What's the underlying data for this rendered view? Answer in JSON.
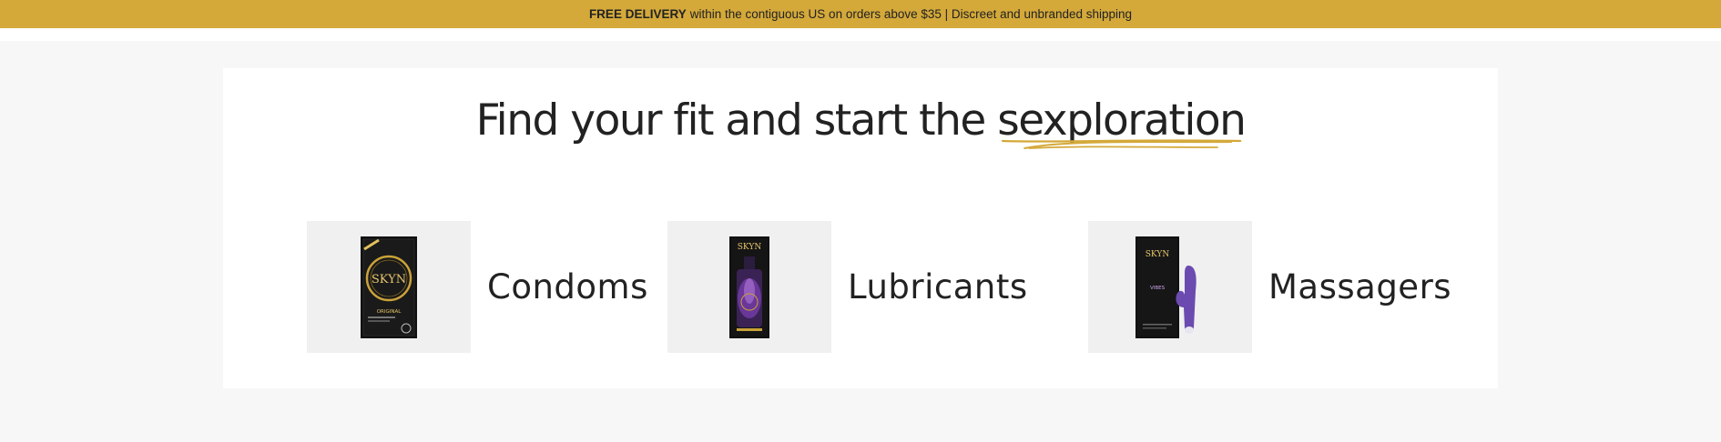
{
  "promo": {
    "bold": "FREE DELIVERY",
    "rest": "within the contiguous US on orders above $35 | Discreet and unbranded shipping"
  },
  "headline": {
    "before": "Find your fit and start the ",
    "highlight": "sexploration"
  },
  "categories": [
    {
      "label": "Condoms",
      "image": "skyn-condom-box",
      "brand": "SKYN",
      "sub": "ORIGINAL"
    },
    {
      "label": "Lubricants",
      "image": "skyn-lubricant-box",
      "brand": "SKYN"
    },
    {
      "label": "Massagers",
      "image": "skyn-massager-box",
      "brand": "SKYN",
      "sub": "VIBES"
    }
  ],
  "colors": {
    "accent": "#d4a93a",
    "card_bg": "#ffffff",
    "page_bg": "#f7f7f7",
    "thumb_bg": "#f0f0f0",
    "text": "#222222",
    "product_purple": "#6b4bb0"
  }
}
